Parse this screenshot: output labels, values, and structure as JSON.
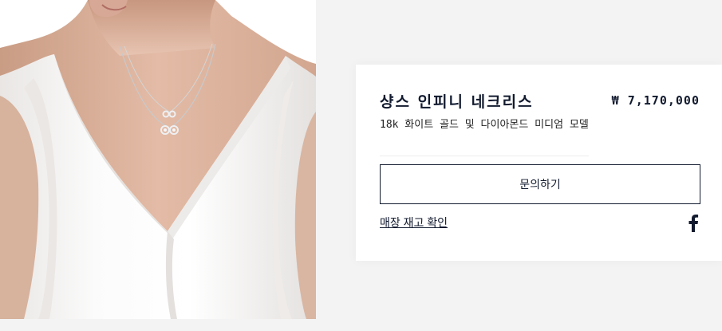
{
  "product": {
    "title": "샹스 인피니 네크리스",
    "price": "₩ 7,170,000",
    "subtitle": "18k 화이트 골드 및 다이아몬드 미디엄 모델",
    "inquire_label": "문의하기",
    "stock_label": "매장 재고 확인"
  },
  "icons": {
    "share": "facebook-icon"
  },
  "colors": {
    "brand": "#111a2e",
    "background": "#f3f3f3",
    "card": "#ffffff"
  }
}
